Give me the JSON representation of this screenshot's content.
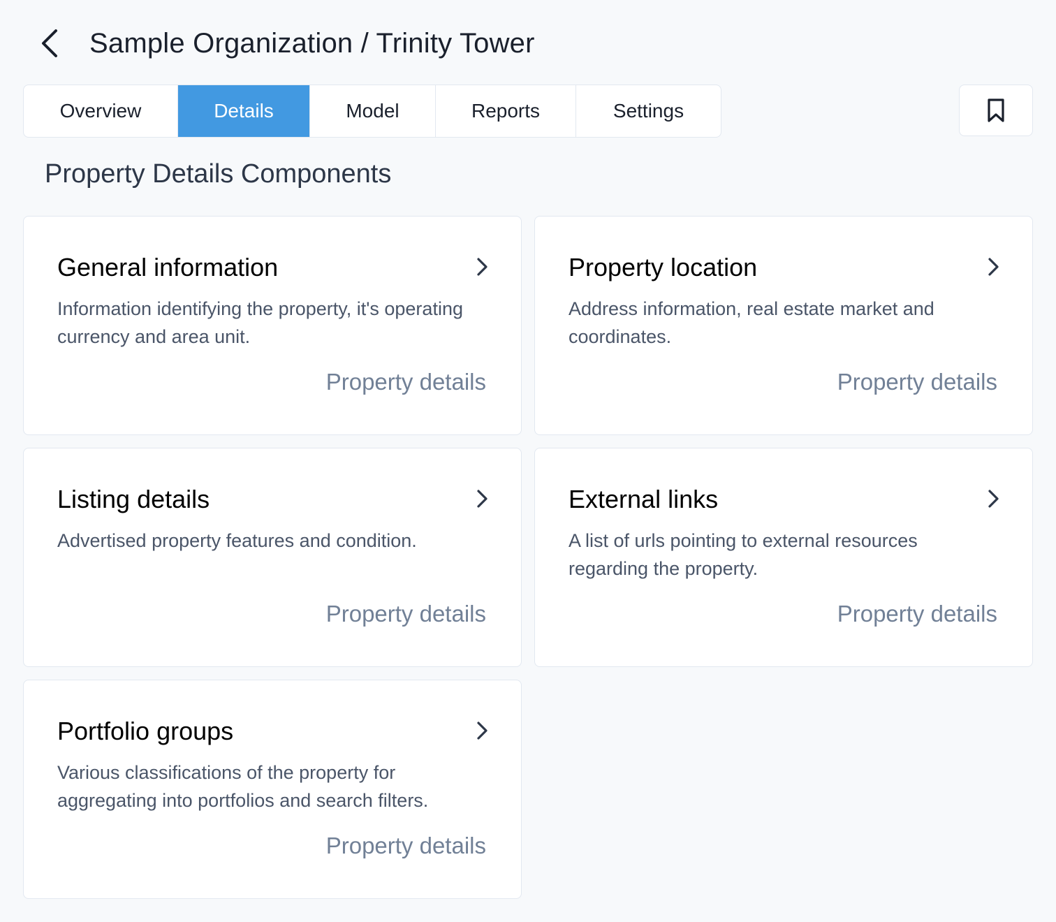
{
  "header": {
    "title": "Sample Organization / Trinity Tower",
    "back_icon": "chevron-left-icon"
  },
  "tabs": [
    {
      "label": "Overview",
      "active": false
    },
    {
      "label": "Details",
      "active": true
    },
    {
      "label": "Model",
      "active": false
    },
    {
      "label": "Reports",
      "active": false
    },
    {
      "label": "Settings",
      "active": false
    }
  ],
  "bookmark": {
    "icon": "bookmark-icon"
  },
  "section": {
    "title": "Property Details Components"
  },
  "cards": [
    {
      "title": "General information",
      "description": "Information identifying the property, it's operating currency and area unit.",
      "link": "Property details"
    },
    {
      "title": "Property location",
      "description": "Address information, real estate market and coordinates.",
      "link": "Property details"
    },
    {
      "title": "Listing details",
      "description": "Advertised property features and condition.",
      "link": "Property details"
    },
    {
      "title": "External links",
      "description": "A list of urls pointing to external resources regarding the property.",
      "link": "Property details"
    },
    {
      "title": "Portfolio groups",
      "description": "Various classifications of the property for aggregating into portfolios and search filters.",
      "link": "Property details"
    }
  ],
  "colors": {
    "background": "#f7f9fb",
    "accent": "#4299e1",
    "border": "#e2e8f0",
    "muted_link": "#718096"
  }
}
